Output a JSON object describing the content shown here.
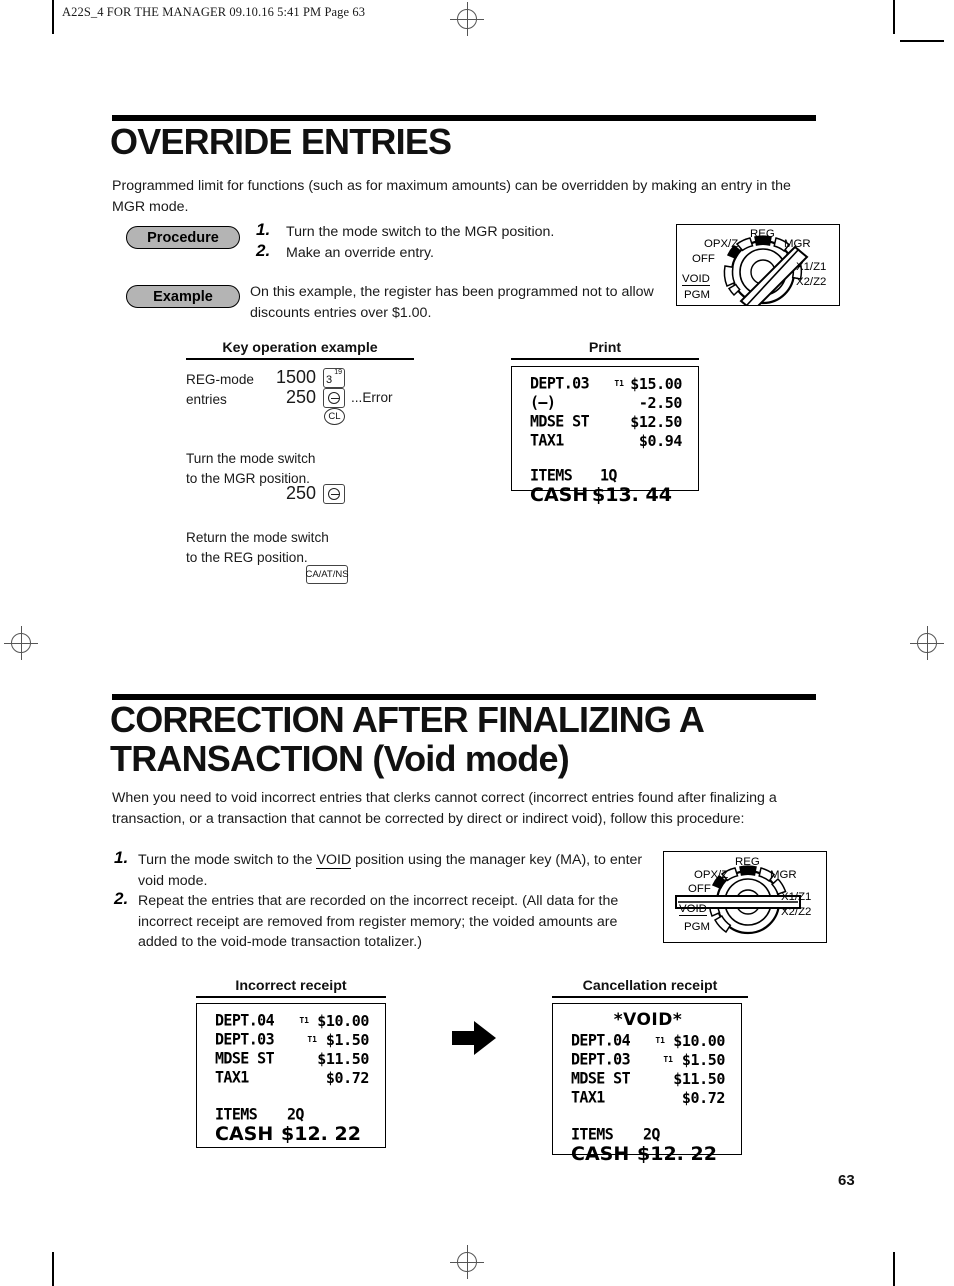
{
  "page_header": "A22S_4 FOR THE MANAGER  09.10.16 5:41 PM  Page 63",
  "page_number": "63",
  "section1": {
    "title": "OVERRIDE ENTRIES",
    "intro": "Programmed limit for functions (such as for maximum amounts) can be overridden by making an entry in the MGR mode.",
    "procedure_label": "Procedure",
    "example_label": "Example",
    "steps": [
      {
        "num": "1.",
        "text": "Turn the mode switch to the MGR position."
      },
      {
        "num": "2.",
        "text": "Make an override entry."
      }
    ],
    "example_text": "On this example, the register has been programmed not to allow discounts entries over $1.00.",
    "dial": {
      "labels": [
        "REG",
        "MGR",
        "X1/Z1",
        "X2/Z2",
        "PGM",
        "VOID",
        "OFF",
        "OPX/Z"
      ],
      "pointer": "MGR"
    },
    "key_op_heading": "Key operation example",
    "print_heading": "Print",
    "key_op": {
      "line1_label": "REG-mode",
      "line2_label": "entries",
      "amount1": "1500",
      "key1": "3",
      "key1_sup": "19",
      "amount2": "250",
      "key2": "minus-key",
      "error_note": "...Error",
      "key3": "CL",
      "note1_line1": "Turn the mode switch",
      "note1_line2": "to the MGR position.",
      "amount3": "250",
      "key4": "minus-key",
      "note2_line1": "Return the mode switch",
      "note2_line2": "to the REG position.",
      "key5": "CA/AT/NS"
    },
    "receipt": {
      "rows": [
        {
          "label": "DEPT.03",
          "tax": "T1",
          "value": "$15.00"
        },
        {
          "label": " (—)",
          "tax": "",
          "value": "-2.50"
        },
        {
          "label": "MDSE ST",
          "tax": "",
          "value": "$12.50"
        },
        {
          "label": "TAX1",
          "tax": "",
          "value": "$0.94"
        }
      ],
      "items_label": "ITEMS",
      "items_value": "1Q",
      "total_label": "CASH",
      "total_value": "$13. 44"
    }
  },
  "section2": {
    "title_line1": "CORRECTION AFTER FINALIZING A",
    "title_line2": "TRANSACTION  (Void mode)",
    "intro": "When you need to void incorrect entries that clerks cannot correct (incorrect entries found after finalizing a transaction, or a transaction that cannot be corrected by direct or indirect void), follow this procedure:",
    "steps": [
      {
        "num": "1.",
        "text_before": "Turn the mode switch to the ",
        "underlined": "VOID",
        "text_after": " position using the manager key (MA), to enter void mode."
      },
      {
        "num": "2.",
        "text": "Repeat the entries that are recorded on the incorrect receipt.  (All data for the incorrect receipt are removed from register memory; the voided amounts are added to the void-mode transaction totalizer.)"
      }
    ],
    "dial": {
      "labels": [
        "REG",
        "MGR",
        "X1/Z1",
        "X2/Z2",
        "PGM",
        "VOID",
        "OFF",
        "OPX/Z"
      ],
      "pointer": "VOID"
    },
    "incorrect_heading": "Incorrect receipt",
    "cancellation_heading": "Cancellation receipt",
    "incorrect_receipt": {
      "rows": [
        {
          "label": "DEPT.04",
          "tax": "T1",
          "value": "$10.00"
        },
        {
          "label": "DEPT.03",
          "tax": "T1",
          "value": "$1.50"
        },
        {
          "label": "MDSE ST",
          "tax": "",
          "value": "$11.50"
        },
        {
          "label": "TAX1",
          "tax": "",
          "value": "$0.72"
        }
      ],
      "items_label": "ITEMS",
      "items_value": "2Q",
      "total_label": "CASH",
      "total_value": "$12. 22"
    },
    "cancellation_receipt": {
      "void_banner": "*VOID*",
      "rows": [
        {
          "label": "DEPT.04",
          "tax": "T1",
          "value": "$10.00"
        },
        {
          "label": "DEPT.03",
          "tax": "T1",
          "value": "$1.50"
        },
        {
          "label": "MDSE ST",
          "tax": "",
          "value": "$11.50"
        },
        {
          "label": "TAX1",
          "tax": "",
          "value": "$0.72"
        }
      ],
      "items_label": "ITEMS",
      "items_value": "2Q",
      "total_label": "CASH",
      "total_value": "$12. 22"
    }
  }
}
